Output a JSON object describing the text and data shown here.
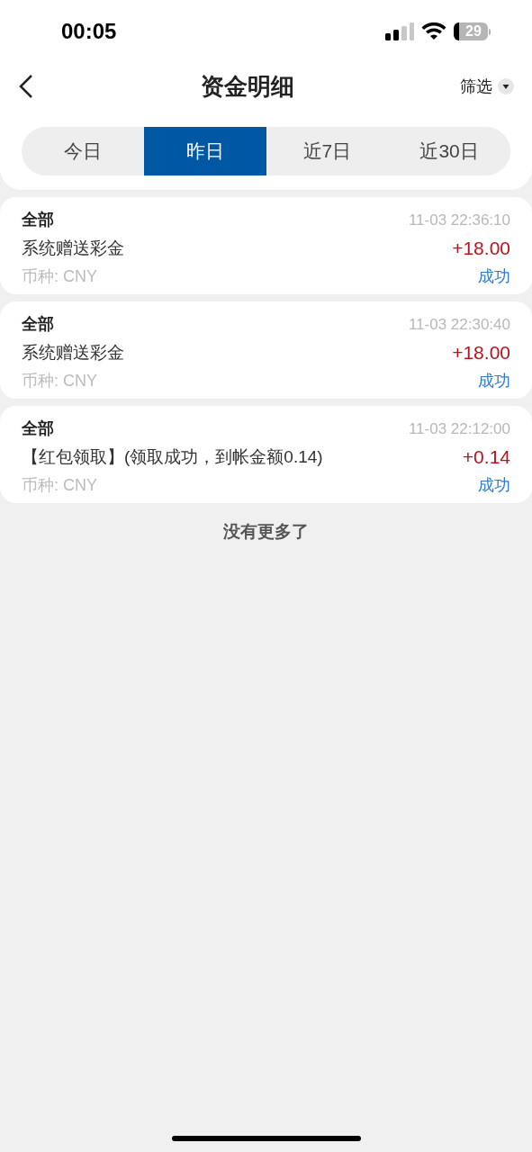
{
  "status_bar": {
    "time": "00:05",
    "battery": "29"
  },
  "header": {
    "title": "资金明细",
    "filter": "筛选"
  },
  "tabs": [
    {
      "label": "今日",
      "selected": false
    },
    {
      "label": "昨日",
      "selected": true
    },
    {
      "label": "近7日",
      "selected": false
    },
    {
      "label": "近30日",
      "selected": false
    }
  ],
  "records": [
    {
      "type": "全部",
      "time": "11-03 22:36:10",
      "description": "系统赠送彩金",
      "amount": "+18.00",
      "currency": "币种: CNY",
      "status": "成功"
    },
    {
      "type": "全部",
      "time": "11-03 22:30:40",
      "description": "系统赠送彩金",
      "amount": "+18.00",
      "currency": "币种: CNY",
      "status": "成功"
    },
    {
      "type": "全部",
      "time": "11-03 22:12:00",
      "description": "【红包领取】(领取成功，到帐金额0.14)",
      "amount": "+0.14",
      "currency": "币种: CNY",
      "status": "成功"
    }
  ],
  "end_message": "没有更多了"
}
